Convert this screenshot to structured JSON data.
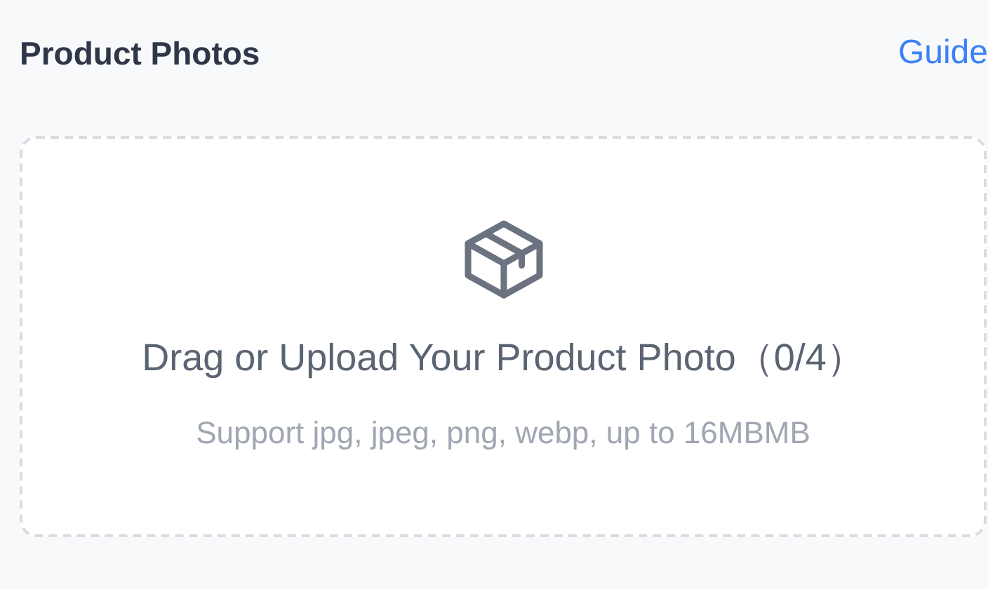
{
  "header": {
    "title": "Product Photos",
    "link": "Guide"
  },
  "upload": {
    "prompt": "Drag or Upload Your Product Photo（0/4）",
    "hint": "Support jpg, jpeg, png, webp, up to 16MBMB"
  }
}
